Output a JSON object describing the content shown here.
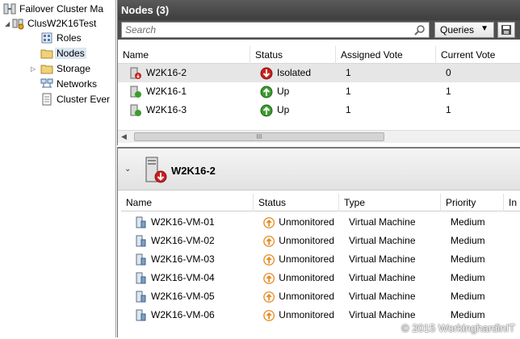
{
  "tree": {
    "root": "Failover Cluster Ma",
    "cluster": "ClusW2K16Test",
    "items": [
      {
        "label": "Roles"
      },
      {
        "label": "Nodes"
      },
      {
        "label": "Storage"
      },
      {
        "label": "Networks"
      },
      {
        "label": "Cluster Ever"
      }
    ]
  },
  "nodes_pane": {
    "title": "Nodes (3)",
    "search_placeholder": "Search",
    "queries_label": "Queries",
    "columns": [
      "Name",
      "Status",
      "Assigned Vote",
      "Current Vote"
    ],
    "rows": [
      {
        "name": "W2K16-2",
        "status": "Isolated",
        "status_icon": "red-down-arrow-icon",
        "assigned_vote": "1",
        "current_vote": "0"
      },
      {
        "name": "W2K16-1",
        "status": "Up",
        "status_icon": "green-up-arrow-icon",
        "assigned_vote": "1",
        "current_vote": "1"
      },
      {
        "name": "W2K16-3",
        "status": "Up",
        "status_icon": "green-up-arrow-icon",
        "assigned_vote": "1",
        "current_vote": "1"
      }
    ],
    "scroll_thumb_glyph": "III"
  },
  "detail_pane": {
    "title": "W2K16-2",
    "columns": [
      "Name",
      "Status",
      "Type",
      "Priority",
      "In"
    ],
    "rows": [
      {
        "name": "W2K16-VM-01",
        "status": "Unmonitored",
        "type": "Virtual Machine",
        "priority": "Medium"
      },
      {
        "name": "W2K16-VM-02",
        "status": "Unmonitored",
        "type": "Virtual Machine",
        "priority": "Medium"
      },
      {
        "name": "W2K16-VM-03",
        "status": "Unmonitored",
        "type": "Virtual Machine",
        "priority": "Medium"
      },
      {
        "name": "W2K16-VM-04",
        "status": "Unmonitored",
        "type": "Virtual Machine",
        "priority": "Medium"
      },
      {
        "name": "W2K16-VM-05",
        "status": "Unmonitored",
        "type": "Virtual Machine",
        "priority": "Medium"
      },
      {
        "name": "W2K16-VM-06",
        "status": "Unmonitored",
        "type": "Virtual Machine",
        "priority": "Medium"
      }
    ]
  },
  "watermark": "© 2015 WorkinghardinIT",
  "colors": {
    "title_bar": "#474747",
    "selected_row": "#e6e6e6",
    "up_green": "#3a9c2c",
    "down_red": "#c8201e",
    "unmonitored_orange": "#e58a1f"
  }
}
